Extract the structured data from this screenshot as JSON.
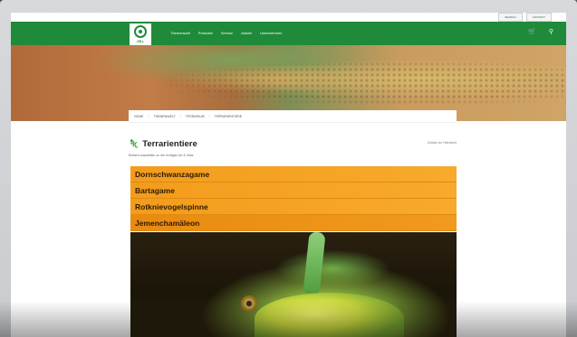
{
  "utility_bar": {
    "buttons": [
      "SEARCH",
      "CONTACT"
    ]
  },
  "header": {
    "logo_text": "JBL",
    "nav": [
      "Themenwelt",
      "Produkte",
      "Service",
      "Aktuell",
      "Unternehmen"
    ],
    "icons": [
      "cart-icon",
      "search-icon"
    ],
    "brand_color": "#1f8a3a"
  },
  "breadcrumb": [
    "HOME",
    "THEMENWELT",
    "TERRARIUM",
    "TERRARIENTIERE"
  ],
  "page": {
    "title": "Terrarientiere",
    "back_link": "Zurück zur Übersicht",
    "subtitle": "Einfach auswählen zu der richtigen Art & Infos"
  },
  "animals": [
    "Dornschwanzagame",
    "Bartagame",
    "Rotknievogelspinne",
    "Jemenchamäleon"
  ],
  "accent_color": "#f39c1c"
}
